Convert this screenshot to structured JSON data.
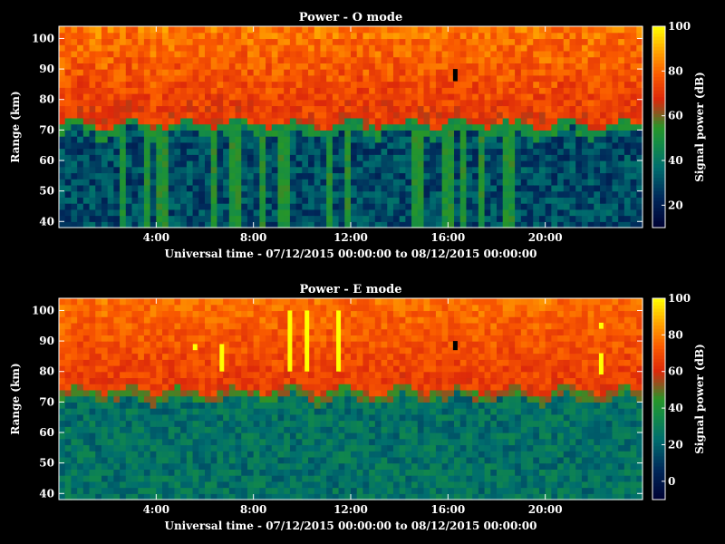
{
  "chart_data": [
    {
      "type": "heatmap",
      "title": "Power - O mode",
      "xlabel": "Universal time - 07/12/2015 00:00:00 to 08/12/2015 00:00:00",
      "ylabel": "Range (km)",
      "colorbar_label": "Signal power (dB)",
      "x_range_hours": [
        0,
        24
      ],
      "x_ticks": [
        "4:00",
        "8:00",
        "12:00",
        "16:00",
        "20:00"
      ],
      "x_tick_hours": [
        4,
        8,
        12,
        16,
        20
      ],
      "y_range_km": [
        38,
        104
      ],
      "y_ticks": [
        40,
        50,
        60,
        70,
        80,
        90,
        100
      ],
      "color_range_db": [
        10,
        100
      ],
      "colorbar_ticks": [
        20,
        40,
        60,
        80,
        100
      ],
      "colorscale": "dark-blue/teal/green/red/orange/yellow",
      "structure": {
        "upper_layer_db": 70,
        "lower_layer_db": 30,
        "boundary_km_approx": 72,
        "n_time_bins": 96,
        "n_range_bins": 33,
        "vertical_band_hours": [
          2.6,
          3.6,
          4.3,
          6.4,
          7.2,
          8.4,
          9.3,
          11.1,
          11.9,
          14.8,
          16.0,
          16.6,
          17.4,
          18.5
        ],
        "black_gap": {
          "hour": 16.3,
          "range_km": [
            86,
            90
          ]
        }
      }
    },
    {
      "type": "heatmap",
      "title": "Power - E mode",
      "xlabel": "Universal time - 07/12/2015 00:00:00 to 08/12/2015 00:00:00",
      "ylabel": "Range (km)",
      "colorbar_label": "Signal power (dB)",
      "x_range_hours": [
        0,
        24
      ],
      "x_ticks": [
        "4:00",
        "8:00",
        "12:00",
        "16:00",
        "20:00"
      ],
      "x_tick_hours": [
        4,
        8,
        12,
        16,
        20
      ],
      "y_range_km": [
        38,
        104
      ],
      "y_ticks": [
        40,
        50,
        60,
        70,
        80,
        90,
        100
      ],
      "color_range_db": [
        -10,
        100
      ],
      "colorbar_ticks": [
        0,
        20,
        40,
        60,
        80,
        100
      ],
      "colorscale": "dark-blue/teal/green/red/orange/yellow",
      "structure": {
        "upper_layer_db": 65,
        "lower_layer_db": 25,
        "boundary_km_approx": 74,
        "n_time_bins": 96,
        "n_range_bins": 33,
        "yellow_spikes": [
          {
            "hour": 5.6,
            "range_km": [
              87,
              89
            ]
          },
          {
            "hour": 6.7,
            "range_km": [
              80,
              89
            ]
          },
          {
            "hour": 9.5,
            "range_km": [
              80,
              100
            ]
          },
          {
            "hour": 10.2,
            "range_km": [
              80,
              100
            ]
          },
          {
            "hour": 11.5,
            "range_km": [
              80,
              100
            ]
          },
          {
            "hour": 22.3,
            "range_km": [
              94,
              96
            ]
          },
          {
            "hour": 22.3,
            "range_km": [
              79,
              86
            ]
          }
        ],
        "black_gap": {
          "hour": 16.3,
          "range_km": [
            87,
            90
          ]
        }
      }
    }
  ]
}
